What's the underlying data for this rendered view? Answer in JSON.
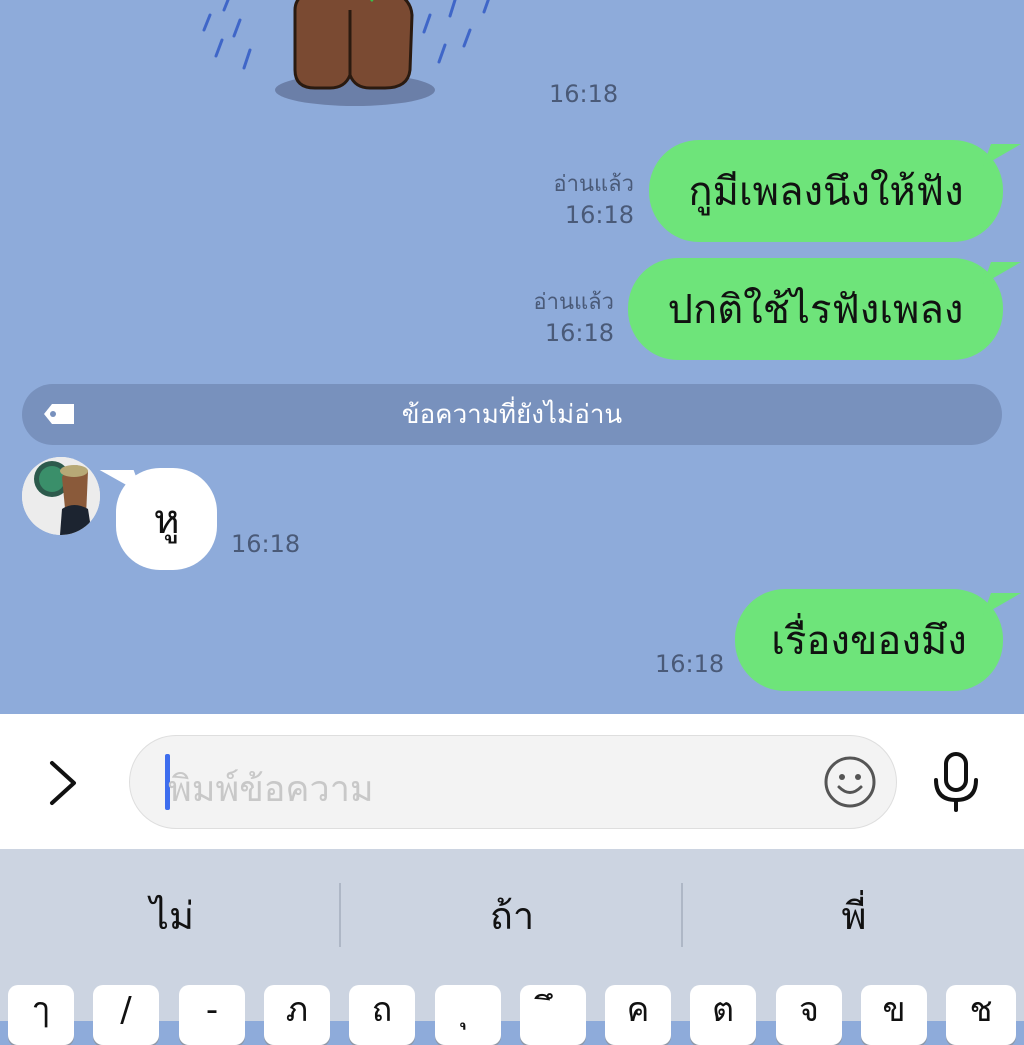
{
  "chat": {
    "sticker_time": "16:18",
    "messages_out": [
      {
        "text": "กูมีเพลงนึงให้ฟัง",
        "read": "อ่านแล้ว",
        "time": "16:18"
      },
      {
        "text": "ปกติใช้ไรฟังเพลง",
        "read": "อ่านแล้ว",
        "time": "16:18"
      },
      {
        "text": "เรื่องของมึง",
        "time": "16:18"
      }
    ],
    "unread_label": "ข้อความที่ยังไม่อ่าน",
    "message_in": {
      "text": "หู",
      "time": "16:18"
    }
  },
  "input": {
    "placeholder": "พิมพ์ข้อความ"
  },
  "keyboard": {
    "suggestions": [
      "ไม่",
      "ถ้า",
      "พี่"
    ],
    "row1": [
      "ๅ",
      "/",
      "-",
      "ภ",
      "ถ",
      "ุ",
      "ึ",
      "ค",
      "ต",
      "จ",
      "ข",
      "ช"
    ]
  },
  "colors": {
    "chat_bg": "#8eabda",
    "bubble_out": "#6ee47a",
    "unread_bar": "#7891bd",
    "caret": "#3d6dee"
  }
}
